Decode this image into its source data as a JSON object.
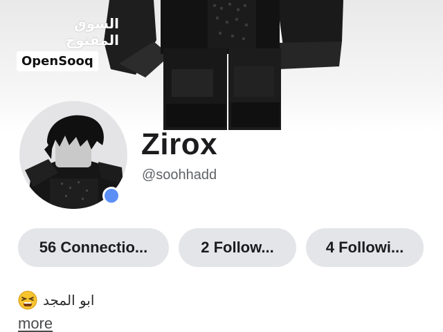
{
  "watermark": {
    "arabic": "السوق المفتوح",
    "brand": "OpenSooq"
  },
  "profile": {
    "display_name": "Zirox",
    "username": "@soohhadd",
    "status_color": "#5b8ff5"
  },
  "stats": [
    {
      "label": "56 Connectio..."
    },
    {
      "label": "2 Follow..."
    },
    {
      "label": "4 Followi..."
    }
  ],
  "about": {
    "text": "ابو المجد",
    "emoji": "tired-face-emoji",
    "more_label": "more"
  },
  "colors": {
    "pill_bg": "#e4e5e8",
    "text": "#1c1c1e",
    "secondary": "#5f6266"
  }
}
